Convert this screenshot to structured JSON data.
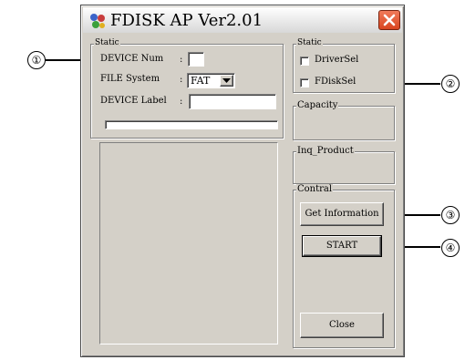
{
  "window": {
    "title": "FDISK AP Ver2.01"
  },
  "left_static": {
    "group_label": "Static",
    "device_num_label": "DEVICE Num",
    "device_num_value": "",
    "file_system_label": "FILE System",
    "file_system_value": "FAT",
    "device_label_label": "DEVICE Label",
    "device_label_value": "",
    "colon": ":"
  },
  "right_static": {
    "group_label": "Static",
    "driver_sel_label": "DriverSel",
    "fdisk_sel_label": "FDiskSel"
  },
  "capacity": {
    "group_label": "Capacity"
  },
  "inq_product": {
    "group_label": "Inq_Product"
  },
  "contral": {
    "group_label": "Contral",
    "get_information_label": "Get Information",
    "start_label": "START",
    "close_label": "Close"
  },
  "callouts": [
    "①",
    "②",
    "③",
    "④"
  ],
  "colors": {
    "close_button": "#d9451f",
    "dialog_face": "#d4d0c8"
  }
}
